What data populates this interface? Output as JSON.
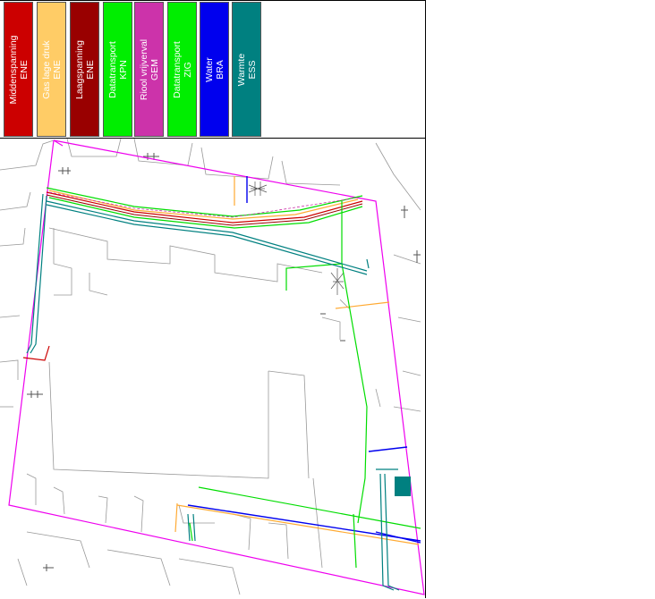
{
  "legend": {
    "items": [
      {
        "line1": "Middenspanning",
        "line2": "ENE",
        "color": "#cc0000",
        "text_color": "#ffffff"
      },
      {
        "line1": "Gas lage druk",
        "line2": "ENE",
        "color": "#ffcc66",
        "text_color": "#ffffff"
      },
      {
        "line1": "Laagspanning",
        "line2": "ENE",
        "color": "#990000",
        "text_color": "#ffffff"
      },
      {
        "line1": "Datatransport",
        "line2": "KPN",
        "color": "#00ee00",
        "text_color": "#ffffff"
      },
      {
        "line1": "Riool vrijverval",
        "line2": "GEM",
        "color": "#cc33aa",
        "text_color": "#ffffff"
      },
      {
        "line1": "Datatransport",
        "line2": "ZIG",
        "color": "#00ee00",
        "text_color": "#ffffff"
      },
      {
        "line1": "Water",
        "line2": "BRA",
        "color": "#0000ee",
        "text_color": "#ffffff"
      },
      {
        "line1": "Warmte",
        "line2": "ESS",
        "color": "#008080",
        "text_color": "#ffffff"
      }
    ]
  },
  "map": {
    "boundary_color": "#ee00ee",
    "building_line_color": "#999999"
  }
}
